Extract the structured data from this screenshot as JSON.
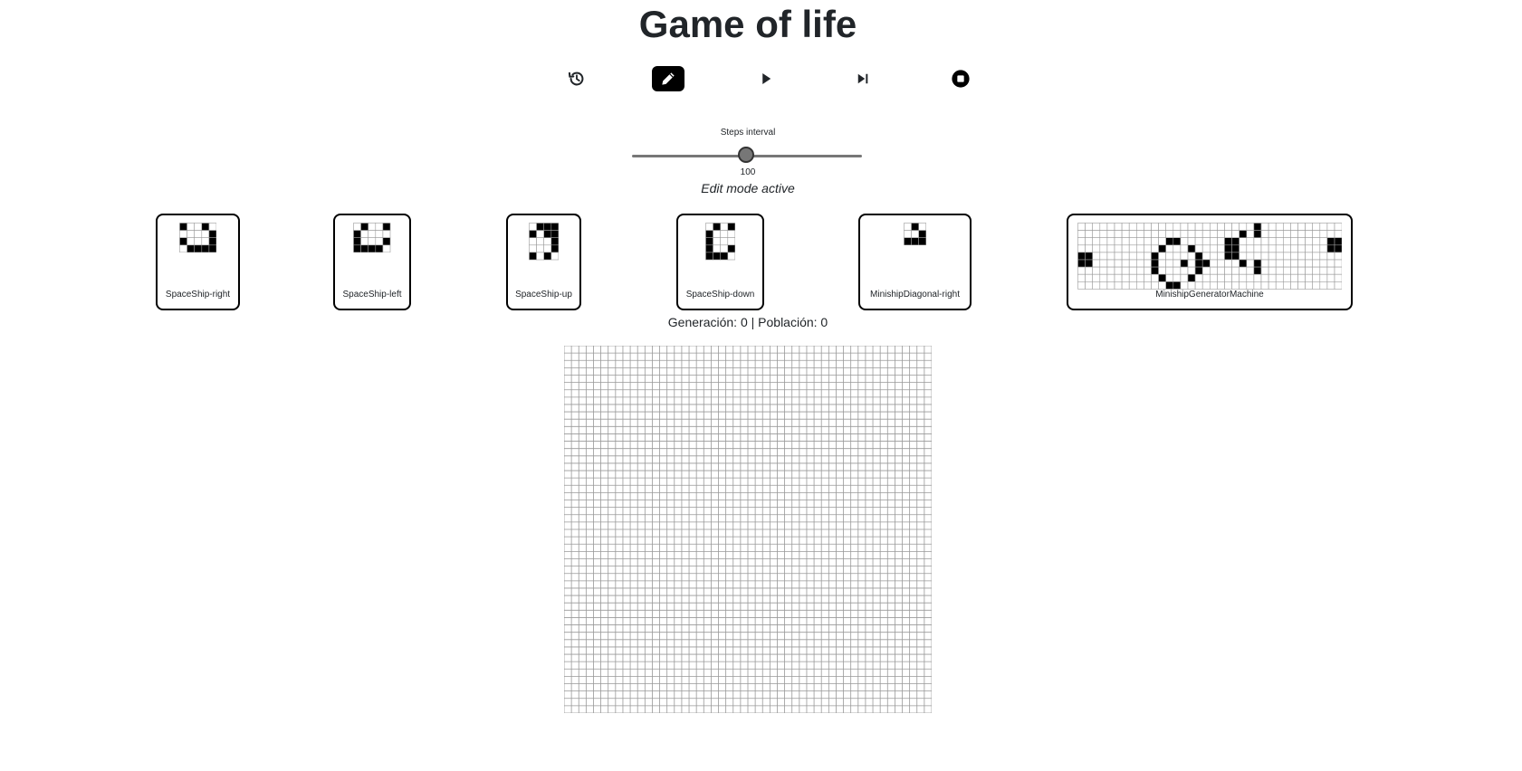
{
  "title": "Game of life",
  "toolbar": [
    {
      "name": "history-icon",
      "icon": "history"
    },
    {
      "name": "edit-icon",
      "icon": "pencil",
      "active": true
    },
    {
      "name": "play-icon",
      "icon": "play"
    },
    {
      "name": "step-icon",
      "icon": "step-forward"
    },
    {
      "name": "stop-icon",
      "icon": "stop-circle"
    }
  ],
  "slider": {
    "label": "Steps interval",
    "value": "100"
  },
  "mode_text": "Edit mode active",
  "patterns": [
    {
      "label": "SpaceShip-right",
      "rows": [
        "10010",
        "00001",
        "10001",
        "01111"
      ]
    },
    {
      "label": "SpaceShip-left",
      "rows": [
        "01001",
        "10000",
        "10001",
        "11110"
      ]
    },
    {
      "label": "SpaceShip-up",
      "rows": [
        "0111",
        "1011",
        "0001",
        "0001",
        "1010"
      ]
    },
    {
      "label": "SpaceShip-down",
      "rows": [
        "0101",
        "1000",
        "1000",
        "1001",
        "1110"
      ]
    },
    {
      "label": "MinishipDiagonal-right",
      "rows": [
        "010",
        "001",
        "111"
      ]
    },
    {
      "label": "MinishipGeneratorMachine",
      "rows": [
        "000000000000000000000000100000000000",
        "000000000000000000000010100000000000",
        "000000000000110000001100000000000011",
        "000000000001000100001100000000000011",
        "110000000010000010001100000000000000",
        "110000000010001011000010100000000000",
        "000000000010000010000000100000000000",
        "000000000001000100000000000000000000",
        "000000000000110000000000000000000000"
      ]
    }
  ],
  "status": {
    "generation_label": "Generación: 0",
    "separator": "|",
    "population_label": "Población: 0"
  },
  "board": {
    "rows": 50,
    "cols": 50,
    "alive_color": "#000000",
    "grid_color": "#999999"
  }
}
